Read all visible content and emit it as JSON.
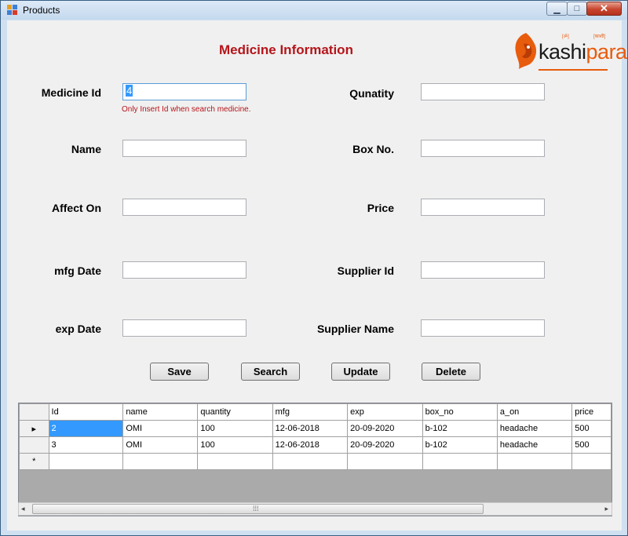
{
  "window": {
    "title": "Products",
    "minimize": "▁",
    "maximize": "□",
    "close": "✕"
  },
  "form": {
    "heading": "Medicine Information",
    "logo": {
      "main": "kashi",
      "accent": "para",
      "small_left": "[ॐ]",
      "small_right": "[काशी]"
    },
    "labels": {
      "medicine_id": "Medicine Id",
      "name": "Name",
      "affect_on": "Affect On",
      "mfg_date": "mfg Date",
      "exp_date": "exp Date",
      "quantity": "Qunatity",
      "box_no": "Box No.",
      "price": "Price",
      "supplier_id": "Supplier Id",
      "supplier_name": "Supplier Name"
    },
    "values": {
      "medicine_id": "4",
      "name": "",
      "affect_on": "",
      "mfg_date": "",
      "exp_date": "",
      "quantity": "",
      "box_no": "",
      "price": "",
      "supplier_id": "",
      "supplier_name": ""
    },
    "hint": "Only Insert Id when search medicine.",
    "buttons": {
      "save": "Save",
      "search": "Search",
      "update": "Update",
      "delete": "Delete"
    }
  },
  "grid": {
    "columns": [
      "Id",
      "name",
      "quantity",
      "mfg",
      "exp",
      "box_no",
      "a_on",
      "price"
    ],
    "rows": [
      {
        "indicator": "▸",
        "cells": [
          "2",
          "OMI",
          "100",
          "12-06-2018",
          "20-09-2020",
          "b-102",
          "headache",
          "500"
        ]
      },
      {
        "indicator": "",
        "cells": [
          "3",
          "OMI",
          "100",
          "12-06-2018",
          "20-09-2020",
          "b-102",
          "headache",
          "500"
        ]
      }
    ],
    "new_row_indicator": "*",
    "scroll": {
      "left": "◂",
      "right": "▸",
      "grip": "⁞⁞⁞"
    }
  },
  "colors": {
    "heading": "#b5151a",
    "selection": "#3399ff",
    "logo_accent": "#e85c0d"
  }
}
